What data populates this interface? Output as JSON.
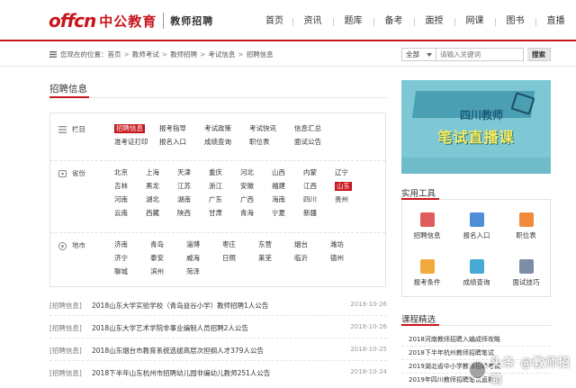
{
  "brand": {
    "logo_latin": "offcn",
    "logo_cn": "中公教育",
    "subtitle": "教师招聘"
  },
  "nav": [
    "首页",
    "资讯",
    "题库",
    "备考",
    "面授",
    "网课",
    "图书",
    "直播"
  ],
  "breadcrumb": {
    "prefix": "您现在的位置：",
    "items": [
      "首页",
      "教师考试",
      "教师招聘",
      "考试信息",
      "招聘信息"
    ],
    "separator": ">"
  },
  "search": {
    "scope": "全部",
    "placeholder": "请输入关键词",
    "button": "搜索"
  },
  "main": {
    "title": "招聘信息"
  },
  "filters": [
    {
      "label": "栏目",
      "options": [
        "招聘信息",
        "报考指导",
        "考试政策",
        "考试快讯",
        "信息汇总",
        "准考证打印",
        "报名入口",
        "成绩查询",
        "职位表",
        "面试公告"
      ],
      "active": "招聘信息"
    },
    {
      "label": "省份",
      "options": [
        "北京",
        "上海",
        "天津",
        "重庆",
        "河北",
        "山西",
        "内蒙",
        "辽宁",
        "吉林",
        "黑龙",
        "江苏",
        "浙江",
        "安徽",
        "福建",
        "江西",
        "山东",
        "河南",
        "湖北",
        "湖南",
        "广东",
        "广西",
        "海南",
        "四川",
        "贵州",
        "云南",
        "西藏",
        "陕西",
        "甘肃",
        "青海",
        "宁夏",
        "新疆"
      ],
      "active": "山东"
    },
    {
      "label": "地市",
      "options": [
        "济南",
        "青岛",
        "淄博",
        "枣庄",
        "东营",
        "烟台",
        "潍坊",
        "济宁",
        "泰安",
        "威海",
        "日照",
        "莱芜",
        "临沂",
        "德州",
        "聊城",
        "滨州",
        "菏泽"
      ],
      "active": ""
    }
  ],
  "articles": [
    {
      "tag": "[招聘信息]",
      "title": "2018山东大学实验学校（青岛益谷小学）教师招聘1人公告",
      "date": "2018-10-26"
    },
    {
      "tag": "[招聘信息]",
      "title": "2018山东大学艺术学院非事业编制人员招聘2人公告",
      "date": "2018-10-26"
    },
    {
      "tag": "[招聘信息]",
      "title": "2018山东烟台市教育系统选拔高层次担纲人才379人公告",
      "date": "2018-10-25"
    },
    {
      "tag": "[招聘信息]",
      "title": "2018下半年山东杭州市招聘幼儿园非编幼儿教师251人公告",
      "date": "2018-10-24"
    }
  ],
  "banner": {
    "line1": "四川教师",
    "line2": "笔试直播课"
  },
  "tools": {
    "title": "实用工具",
    "items": [
      {
        "label": "招聘信息",
        "color": "#e05b5b"
      },
      {
        "label": "报名入口",
        "color": "#4f8fd8"
      },
      {
        "label": "职位表",
        "color": "#f08a3c"
      },
      {
        "label": "报考条件",
        "color": "#f2a93b"
      },
      {
        "label": "成绩查询",
        "color": "#47a9d6"
      },
      {
        "label": "面试技巧",
        "color": "#7c8ea6"
      }
    ]
  },
  "courses": {
    "title": "课程精选",
    "items": [
      "2018河南教师招聘入编成师攻略",
      "2018下半年杭州教师招聘笔试",
      "2019湖北省中小学教师招聘考试",
      "2019年四川教师招聘笔试直播课"
    ]
  },
  "watermark": {
    "text": "头条 @教师招聘"
  }
}
